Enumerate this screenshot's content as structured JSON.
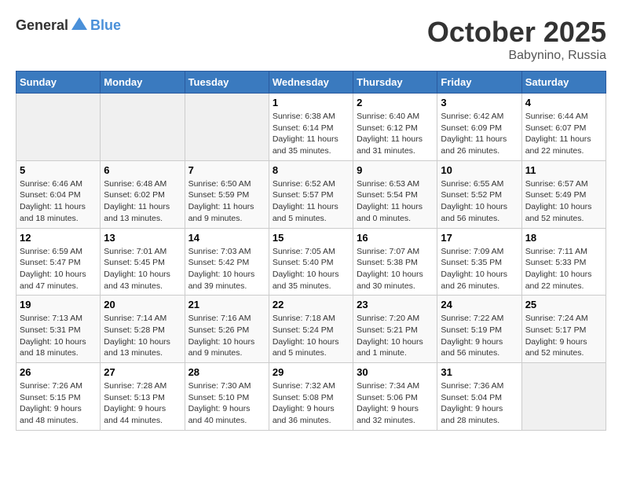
{
  "header": {
    "logo_general": "General",
    "logo_blue": "Blue",
    "month_year": "October 2025",
    "location": "Babynino, Russia"
  },
  "days_of_week": [
    "Sunday",
    "Monday",
    "Tuesday",
    "Wednesday",
    "Thursday",
    "Friday",
    "Saturday"
  ],
  "weeks": [
    [
      {
        "day": "",
        "sunrise": "",
        "sunset": "",
        "daylight": ""
      },
      {
        "day": "",
        "sunrise": "",
        "sunset": "",
        "daylight": ""
      },
      {
        "day": "",
        "sunrise": "",
        "sunset": "",
        "daylight": ""
      },
      {
        "day": "1",
        "sunrise": "Sunrise: 6:38 AM",
        "sunset": "Sunset: 6:14 PM",
        "daylight": "Daylight: 11 hours and 35 minutes."
      },
      {
        "day": "2",
        "sunrise": "Sunrise: 6:40 AM",
        "sunset": "Sunset: 6:12 PM",
        "daylight": "Daylight: 11 hours and 31 minutes."
      },
      {
        "day": "3",
        "sunrise": "Sunrise: 6:42 AM",
        "sunset": "Sunset: 6:09 PM",
        "daylight": "Daylight: 11 hours and 26 minutes."
      },
      {
        "day": "4",
        "sunrise": "Sunrise: 6:44 AM",
        "sunset": "Sunset: 6:07 PM",
        "daylight": "Daylight: 11 hours and 22 minutes."
      }
    ],
    [
      {
        "day": "5",
        "sunrise": "Sunrise: 6:46 AM",
        "sunset": "Sunset: 6:04 PM",
        "daylight": "Daylight: 11 hours and 18 minutes."
      },
      {
        "day": "6",
        "sunrise": "Sunrise: 6:48 AM",
        "sunset": "Sunset: 6:02 PM",
        "daylight": "Daylight: 11 hours and 13 minutes."
      },
      {
        "day": "7",
        "sunrise": "Sunrise: 6:50 AM",
        "sunset": "Sunset: 5:59 PM",
        "daylight": "Daylight: 11 hours and 9 minutes."
      },
      {
        "day": "8",
        "sunrise": "Sunrise: 6:52 AM",
        "sunset": "Sunset: 5:57 PM",
        "daylight": "Daylight: 11 hours and 5 minutes."
      },
      {
        "day": "9",
        "sunrise": "Sunrise: 6:53 AM",
        "sunset": "Sunset: 5:54 PM",
        "daylight": "Daylight: 11 hours and 0 minutes."
      },
      {
        "day": "10",
        "sunrise": "Sunrise: 6:55 AM",
        "sunset": "Sunset: 5:52 PM",
        "daylight": "Daylight: 10 hours and 56 minutes."
      },
      {
        "day": "11",
        "sunrise": "Sunrise: 6:57 AM",
        "sunset": "Sunset: 5:49 PM",
        "daylight": "Daylight: 10 hours and 52 minutes."
      }
    ],
    [
      {
        "day": "12",
        "sunrise": "Sunrise: 6:59 AM",
        "sunset": "Sunset: 5:47 PM",
        "daylight": "Daylight: 10 hours and 47 minutes."
      },
      {
        "day": "13",
        "sunrise": "Sunrise: 7:01 AM",
        "sunset": "Sunset: 5:45 PM",
        "daylight": "Daylight: 10 hours and 43 minutes."
      },
      {
        "day": "14",
        "sunrise": "Sunrise: 7:03 AM",
        "sunset": "Sunset: 5:42 PM",
        "daylight": "Daylight: 10 hours and 39 minutes."
      },
      {
        "day": "15",
        "sunrise": "Sunrise: 7:05 AM",
        "sunset": "Sunset: 5:40 PM",
        "daylight": "Daylight: 10 hours and 35 minutes."
      },
      {
        "day": "16",
        "sunrise": "Sunrise: 7:07 AM",
        "sunset": "Sunset: 5:38 PM",
        "daylight": "Daylight: 10 hours and 30 minutes."
      },
      {
        "day": "17",
        "sunrise": "Sunrise: 7:09 AM",
        "sunset": "Sunset: 5:35 PM",
        "daylight": "Daylight: 10 hours and 26 minutes."
      },
      {
        "day": "18",
        "sunrise": "Sunrise: 7:11 AM",
        "sunset": "Sunset: 5:33 PM",
        "daylight": "Daylight: 10 hours and 22 minutes."
      }
    ],
    [
      {
        "day": "19",
        "sunrise": "Sunrise: 7:13 AM",
        "sunset": "Sunset: 5:31 PM",
        "daylight": "Daylight: 10 hours and 18 minutes."
      },
      {
        "day": "20",
        "sunrise": "Sunrise: 7:14 AM",
        "sunset": "Sunset: 5:28 PM",
        "daylight": "Daylight: 10 hours and 13 minutes."
      },
      {
        "day": "21",
        "sunrise": "Sunrise: 7:16 AM",
        "sunset": "Sunset: 5:26 PM",
        "daylight": "Daylight: 10 hours and 9 minutes."
      },
      {
        "day": "22",
        "sunrise": "Sunrise: 7:18 AM",
        "sunset": "Sunset: 5:24 PM",
        "daylight": "Daylight: 10 hours and 5 minutes."
      },
      {
        "day": "23",
        "sunrise": "Sunrise: 7:20 AM",
        "sunset": "Sunset: 5:21 PM",
        "daylight": "Daylight: 10 hours and 1 minute."
      },
      {
        "day": "24",
        "sunrise": "Sunrise: 7:22 AM",
        "sunset": "Sunset: 5:19 PM",
        "daylight": "Daylight: 9 hours and 56 minutes."
      },
      {
        "day": "25",
        "sunrise": "Sunrise: 7:24 AM",
        "sunset": "Sunset: 5:17 PM",
        "daylight": "Daylight: 9 hours and 52 minutes."
      }
    ],
    [
      {
        "day": "26",
        "sunrise": "Sunrise: 7:26 AM",
        "sunset": "Sunset: 5:15 PM",
        "daylight": "Daylight: 9 hours and 48 minutes."
      },
      {
        "day": "27",
        "sunrise": "Sunrise: 7:28 AM",
        "sunset": "Sunset: 5:13 PM",
        "daylight": "Daylight: 9 hours and 44 minutes."
      },
      {
        "day": "28",
        "sunrise": "Sunrise: 7:30 AM",
        "sunset": "Sunset: 5:10 PM",
        "daylight": "Daylight: 9 hours and 40 minutes."
      },
      {
        "day": "29",
        "sunrise": "Sunrise: 7:32 AM",
        "sunset": "Sunset: 5:08 PM",
        "daylight": "Daylight: 9 hours and 36 minutes."
      },
      {
        "day": "30",
        "sunrise": "Sunrise: 7:34 AM",
        "sunset": "Sunset: 5:06 PM",
        "daylight": "Daylight: 9 hours and 32 minutes."
      },
      {
        "day": "31",
        "sunrise": "Sunrise: 7:36 AM",
        "sunset": "Sunset: 5:04 PM",
        "daylight": "Daylight: 9 hours and 28 minutes."
      },
      {
        "day": "",
        "sunrise": "",
        "sunset": "",
        "daylight": ""
      }
    ]
  ]
}
